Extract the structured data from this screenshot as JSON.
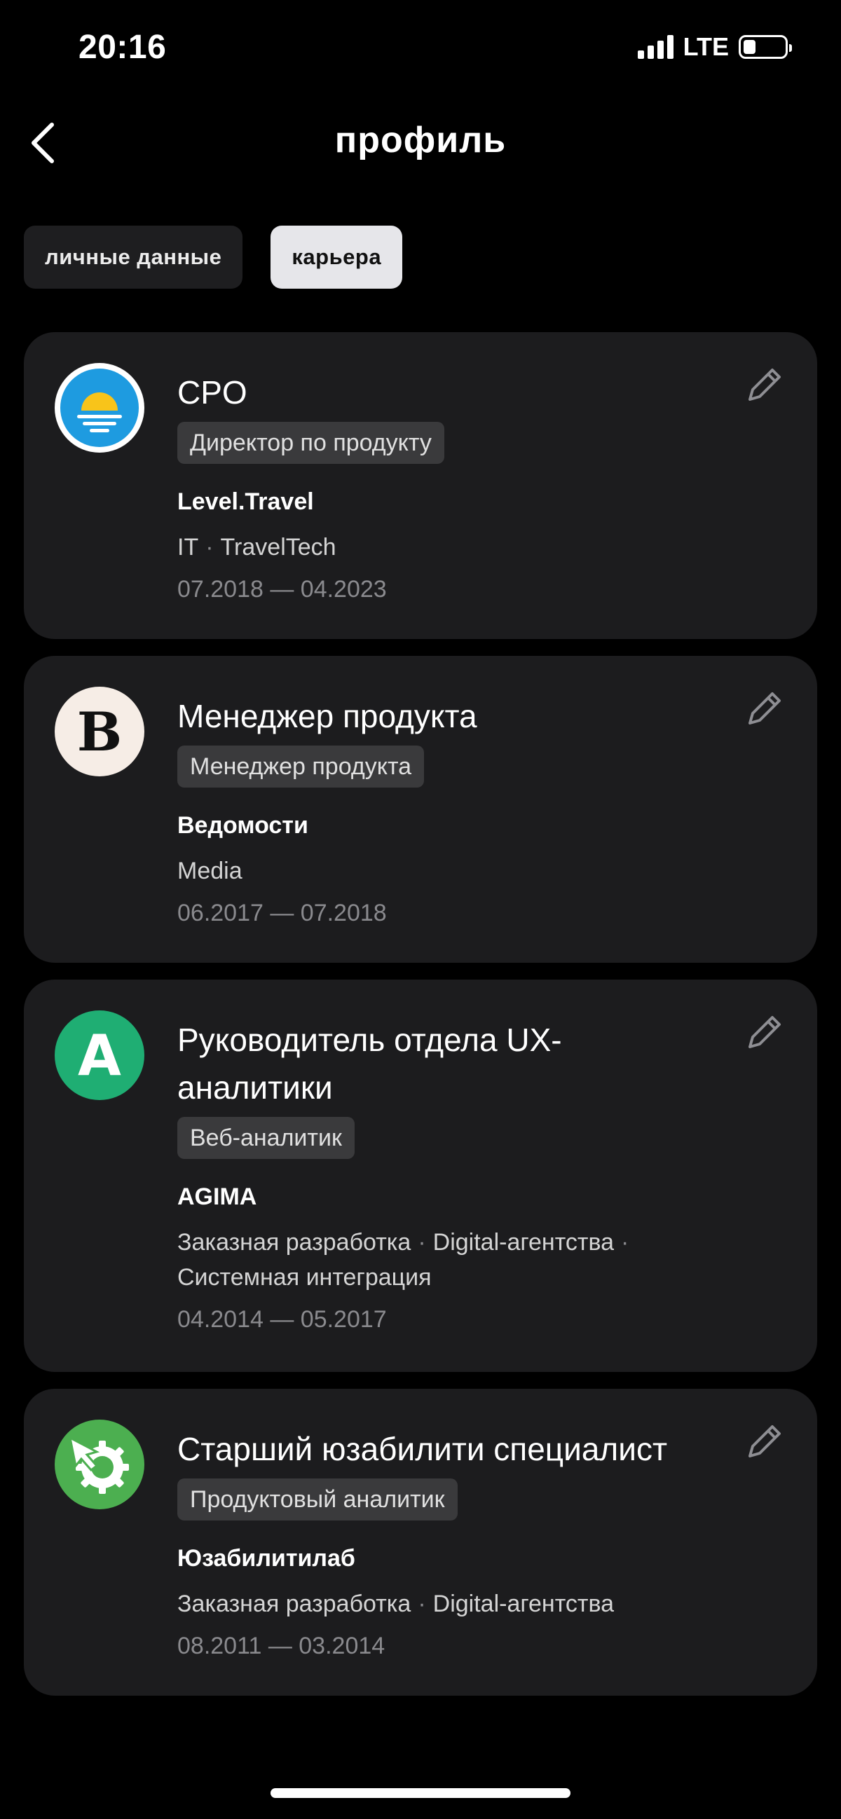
{
  "status_bar": {
    "time": "20:16",
    "network": "LTE",
    "battery_fraction": 0.3
  },
  "header": {
    "title": "профиль"
  },
  "tabs": [
    {
      "label": "личные данные",
      "active": false
    },
    {
      "label": "карьера",
      "active": true
    }
  ],
  "careers": [
    {
      "role": "CPO",
      "badge": "Директор по продукту",
      "company": "Level.Travel",
      "industries": [
        "IT",
        "TravelTech"
      ],
      "dates": "07.2018 — 04.2023",
      "logo_icon": "sunset-icon"
    },
    {
      "role": "Менеджер продукта",
      "badge": "Менеджер продукта",
      "company": "Ведомости",
      "industries": [
        "Media"
      ],
      "dates": "06.2017 — 07.2018",
      "logo_icon": "letter-b-icon",
      "logo_text": "B"
    },
    {
      "role": "Руководитель отдела UX-аналитики",
      "badge": "Веб-аналитик",
      "company": "AGIMA",
      "industries": [
        "Заказная разработка",
        "Digital-агентства",
        "Системная интеграция"
      ],
      "dates": "04.2014 — 05.2017",
      "logo_icon": "letter-a-icon",
      "logo_text": "A"
    },
    {
      "role": "Старший юзабилити специалист",
      "badge": "Продуктовый аналитик",
      "company": "Юзабилитилаб",
      "industries": [
        "Заказная разработка",
        "Digital-агентства"
      ],
      "dates": "08.2011 — 03.2014",
      "logo_icon": "gear-arrow-icon"
    }
  ],
  "colors": {
    "background": "#000000",
    "card": "#1c1c1e",
    "badge": "#3a3a3c",
    "active_tab": "#e6e6ea",
    "muted_text": "#8a8a8e",
    "agima_green": "#1fae73",
    "usabilitylab_green": "#4caf50",
    "level_blue": "#1e9be0"
  }
}
